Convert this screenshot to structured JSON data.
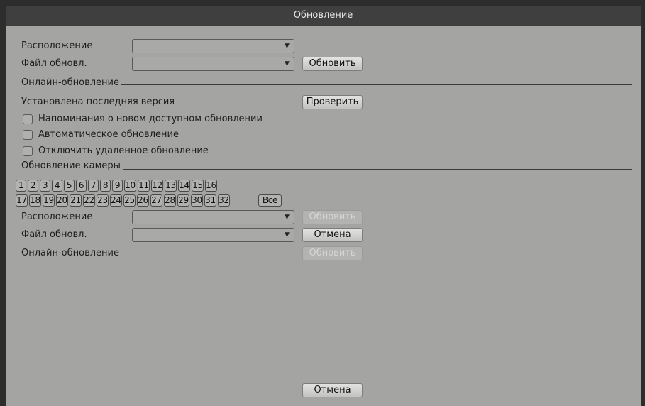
{
  "window": {
    "title": "Обновление"
  },
  "file_update": {
    "location_label": "Расположение",
    "location_value": "",
    "file_label": "Файл обновл.",
    "file_value": "",
    "update_button": "Обновить"
  },
  "online_update": {
    "section_label": "Онлайн-обновление",
    "status_text": "Установлена последняя версия",
    "check_button": "Проверить",
    "checkboxes": [
      {
        "label": "Напоминания о новом доступном обновлении",
        "checked": false
      },
      {
        "label": "Автоматическое обновление",
        "checked": false
      },
      {
        "label": "Отключить удаленное обновление",
        "checked": false
      }
    ]
  },
  "camera_update": {
    "section_label": "Обновление камеры",
    "channels_row1": [
      "1",
      "2",
      "3",
      "4",
      "5",
      "6",
      "7",
      "8",
      "9",
      "10",
      "11",
      "12",
      "13",
      "14",
      "15",
      "16"
    ],
    "channels_row2": [
      "17",
      "18",
      "19",
      "20",
      "21",
      "22",
      "23",
      "24",
      "25",
      "26",
      "27",
      "28",
      "29",
      "30",
      "31",
      "32"
    ],
    "all_button": "Все",
    "location_label": "Расположение",
    "location_value": "",
    "update_button": "Обновить",
    "file_label": "Файл обновл.",
    "file_value": "",
    "cancel_button": "Отмена",
    "online_label": "Онлайн-обновление",
    "online_button": "Обновить"
  },
  "footer": {
    "cancel_button": "Отмена"
  },
  "icons": {
    "dropdown": "dropdown-arrow-icon"
  }
}
